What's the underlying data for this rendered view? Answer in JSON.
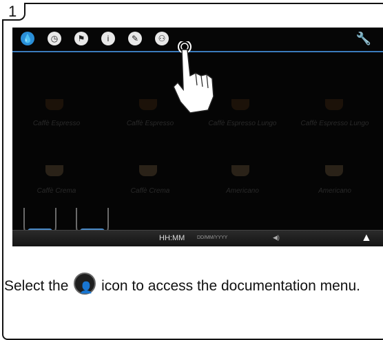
{
  "step": {
    "number": "1"
  },
  "toolbar": {
    "icons": [
      {
        "name": "water-drop-icon",
        "glyph": "💧"
      },
      {
        "name": "clock-icon",
        "glyph": "◷"
      },
      {
        "name": "flag-icon",
        "glyph": "⚑"
      },
      {
        "name": "info-icon",
        "glyph": "i"
      },
      {
        "name": "pencil-icon",
        "glyph": "✎"
      },
      {
        "name": "documentation-icon",
        "glyph": "⚇"
      }
    ],
    "wrench_glyph": "🔧"
  },
  "drinks": {
    "row1": [
      "Caffè Espresso",
      "Caffè Espresso",
      "Caffè Espresso Lungo",
      "Caffè Espresso Lungo"
    ],
    "row2": [
      "Caffè Crema",
      "Caffè Crema",
      "Americano",
      "Americano"
    ]
  },
  "statusbar": {
    "time": "HH:MM",
    "date": "DD/MM/YYYY",
    "volume": "◀)",
    "up": "▲"
  },
  "caption": {
    "before": "Select the ",
    "after": " icon to access the documentation menu."
  }
}
